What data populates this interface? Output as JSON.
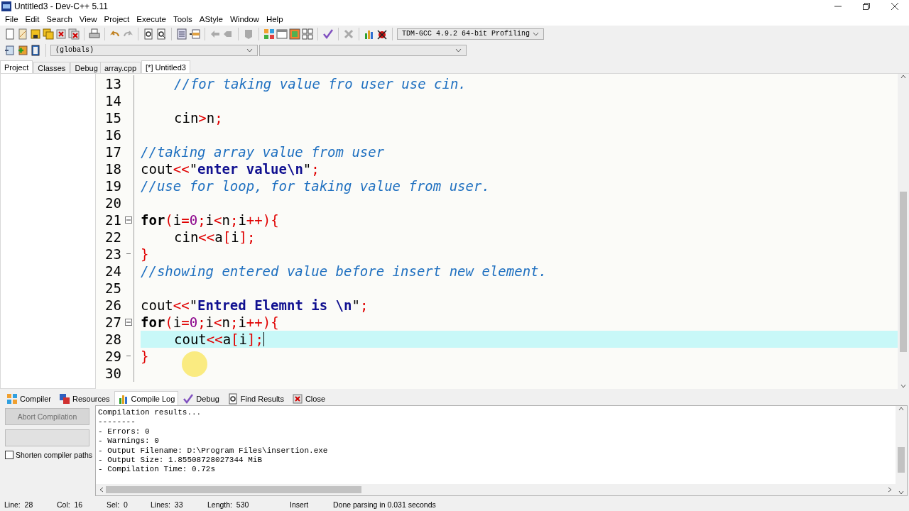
{
  "window": {
    "title": "Untitled3 - Dev-C++ 5.11"
  },
  "menu": [
    "File",
    "Edit",
    "Search",
    "View",
    "Project",
    "Execute",
    "Tools",
    "AStyle",
    "Window",
    "Help"
  ],
  "compiler_select": {
    "value": "TDM-GCC 4.9.2 64-bit Profiling"
  },
  "scope_select": {
    "value": "(globals)"
  },
  "left_tabs": [
    {
      "label": "Project",
      "selected": true
    },
    {
      "label": "Classes",
      "selected": false
    },
    {
      "label": "Debug",
      "selected": false
    }
  ],
  "editor_tabs": [
    {
      "label": "array.cpp",
      "selected": false
    },
    {
      "label": "[*] Untitled3",
      "selected": true
    }
  ],
  "editor": {
    "lines": [
      {
        "number": "13",
        "current": false,
        "indented": true,
        "fold_start": false,
        "fold_end": false,
        "tokens": [
          {
            "kind": "comment",
            "text": "//for taking value fro user use cin."
          }
        ]
      },
      {
        "number": "14",
        "current": false,
        "fold_start": false,
        "fold_end": false
      },
      {
        "number": "15",
        "current": false,
        "indented": true,
        "fold_start": false,
        "fold_end": false,
        "tokens": [
          {
            "kind": "plain",
            "text": "cin"
          },
          {
            "kind": "op",
            "text": ">"
          },
          {
            "kind": "plain",
            "text": "n"
          },
          {
            "kind": "op",
            "text": ";"
          }
        ]
      },
      {
        "number": "16",
        "current": false,
        "fold_start": false,
        "fold_end": false
      },
      {
        "number": "17",
        "current": false,
        "indented": false,
        "fold_start": false,
        "fold_end": false,
        "tokens": [
          {
            "kind": "comment",
            "text": "//taking array value from user"
          }
        ]
      },
      {
        "number": "18",
        "current": false,
        "indented": false,
        "fold_start": false,
        "fold_end": false,
        "tokens": [
          {
            "kind": "plain",
            "text": "cout"
          },
          {
            "kind": "op",
            "text": "<<"
          },
          {
            "kind": "plain",
            "text": "\""
          },
          {
            "kind": "string",
            "text": "enter value\\n"
          },
          {
            "kind": "plain",
            "text": "\""
          },
          {
            "kind": "op",
            "text": ";"
          }
        ]
      },
      {
        "number": "19",
        "current": false,
        "indented": false,
        "fold_start": false,
        "fold_end": false,
        "tokens": [
          {
            "kind": "comment",
            "text": "//use for loop, for taking value from user."
          }
        ]
      },
      {
        "number": "20",
        "current": false,
        "fold_start": false,
        "fold_end": false
      },
      {
        "number": "21",
        "current": false,
        "indented": false,
        "fold_start": true,
        "fold_end": false,
        "tokens": [
          {
            "kind": "keyword",
            "text": "for"
          },
          {
            "kind": "op",
            "text": "("
          },
          {
            "kind": "plain",
            "text": "i"
          },
          {
            "kind": "op",
            "text": "="
          },
          {
            "kind": "number",
            "text": "0"
          },
          {
            "kind": "op",
            "text": ";"
          },
          {
            "kind": "plain",
            "text": "i"
          },
          {
            "kind": "op",
            "text": "<"
          },
          {
            "kind": "plain",
            "text": "n"
          },
          {
            "kind": "op",
            "text": ";"
          },
          {
            "kind": "plain",
            "text": "i"
          },
          {
            "kind": "op",
            "text": "++){"
          }
        ]
      },
      {
        "number": "22",
        "current": false,
        "indented": true,
        "fold_start": false,
        "fold_end": false,
        "tokens": [
          {
            "kind": "plain",
            "text": "cin"
          },
          {
            "kind": "op",
            "text": "<<"
          },
          {
            "kind": "plain",
            "text": "a"
          },
          {
            "kind": "op",
            "text": "["
          },
          {
            "kind": "plain",
            "text": "i"
          },
          {
            "kind": "op",
            "text": "];"
          }
        ]
      },
      {
        "number": "23",
        "current": false,
        "indented": false,
        "fold_start": false,
        "fold_end": true,
        "tokens": [
          {
            "kind": "op",
            "text": "}"
          }
        ]
      },
      {
        "number": "24",
        "current": false,
        "indented": false,
        "fold_start": false,
        "fold_end": false,
        "tokens": [
          {
            "kind": "comment",
            "text": "//showing entered value before insert new element."
          }
        ]
      },
      {
        "number": "25",
        "current": false,
        "fold_start": false,
        "fold_end": false
      },
      {
        "number": "26",
        "current": false,
        "indented": false,
        "fold_start": false,
        "fold_end": false,
        "tokens": [
          {
            "kind": "plain",
            "text": "cout"
          },
          {
            "kind": "op",
            "text": "<<"
          },
          {
            "kind": "plain",
            "text": "\""
          },
          {
            "kind": "string",
            "text": "Entred Elemnt is \\n"
          },
          {
            "kind": "plain",
            "text": "\""
          },
          {
            "kind": "op",
            "text": ";"
          }
        ]
      },
      {
        "number": "27",
        "current": false,
        "indented": false,
        "fold_start": true,
        "fold_end": false,
        "tokens": [
          {
            "kind": "keyword",
            "text": "for"
          },
          {
            "kind": "op",
            "text": "("
          },
          {
            "kind": "plain",
            "text": "i"
          },
          {
            "kind": "op",
            "text": "="
          },
          {
            "kind": "number",
            "text": "0"
          },
          {
            "kind": "op",
            "text": ";"
          },
          {
            "kind": "plain",
            "text": "i"
          },
          {
            "kind": "op",
            "text": "<"
          },
          {
            "kind": "plain",
            "text": "n"
          },
          {
            "kind": "op",
            "text": ";"
          },
          {
            "kind": "plain",
            "text": "i"
          },
          {
            "kind": "op",
            "text": "++){"
          }
        ]
      },
      {
        "number": "28",
        "current": true,
        "indented": true,
        "fold_start": false,
        "fold_end": false,
        "tokens": [
          {
            "kind": "plain",
            "text": "cout"
          },
          {
            "kind": "op",
            "text": "<<"
          },
          {
            "kind": "plain",
            "text": "a"
          },
          {
            "kind": "op",
            "text": "["
          },
          {
            "kind": "plain",
            "text": "i"
          },
          {
            "kind": "op",
            "text": "];"
          }
        ]
      },
      {
        "number": "29",
        "current": false,
        "indented": false,
        "fold_start": false,
        "fold_end": true,
        "tokens": [
          {
            "kind": "op",
            "text": "}"
          }
        ]
      },
      {
        "number": "30",
        "current": false,
        "fold_start": false,
        "fold_end": false
      }
    ]
  },
  "bottom_tabs": [
    {
      "label": "Compiler",
      "selected": false
    },
    {
      "label": "Resources",
      "selected": false
    },
    {
      "label": "Compile Log",
      "selected": true
    },
    {
      "label": "Debug",
      "selected": false
    },
    {
      "label": "Find Results",
      "selected": false
    },
    {
      "label": "Close",
      "selected": false
    }
  ],
  "compile_panel": {
    "abort_button": {
      "label": "Abort Compilation",
      "disabled": true
    },
    "shorten_paths": {
      "label": "Shorten compiler paths",
      "checked": false
    },
    "log": [
      "Compilation results...",
      "--------",
      "- Errors: 0",
      "- Warnings: 0",
      "- Output Filename: D:\\Program Files\\insertion.exe",
      "- Output Size: 1.85508728027344 MiB",
      "- Compilation Time: 0.72s"
    ]
  },
  "status_bar": {
    "fields": [
      {
        "label": "Line:",
        "value": "28"
      },
      {
        "label": "Col:",
        "value": "16"
      },
      {
        "label": "Sel:",
        "value": "0"
      },
      {
        "label": "Lines:",
        "value": "33"
      },
      {
        "label": "Length:",
        "value": "530"
      }
    ],
    "mode": "Insert",
    "message": "Done parsing in 0.031 seconds"
  }
}
